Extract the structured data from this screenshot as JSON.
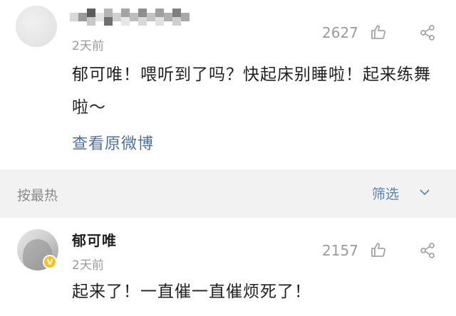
{
  "post": {
    "time": "2天前",
    "like_count": "2627",
    "text": "郁可唯！喂听到了吗？快起床别睡啦！起来练舞啦～",
    "view_original": "查看原微博"
  },
  "sort_bar": {
    "sort_label": "按最热",
    "filter_label": "筛选"
  },
  "comment": {
    "author": "郁可唯",
    "time": "2天前",
    "like_count": "2157",
    "text": "起来了！一直催一直催烦死了！"
  },
  "colors": {
    "link": "#4e71a3",
    "filter": "#5e82b2",
    "badge": "#f7c21e",
    "sort_bar_bg": "#f2f2f2"
  },
  "icons": [
    "thumbs-up-icon",
    "share-icon",
    "chevron-down-icon",
    "verified-badge-icon"
  ]
}
